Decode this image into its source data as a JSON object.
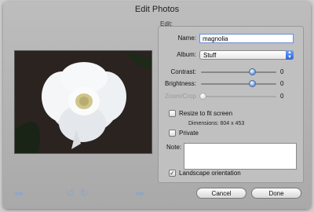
{
  "window": {
    "title": "Edit Photos"
  },
  "edit_group": {
    "label": "Edit:"
  },
  "name": {
    "label": "Name:",
    "value": "magnolia"
  },
  "album": {
    "label": "Album:",
    "value": "Stuff"
  },
  "contrast": {
    "label": "Contrast:",
    "value": "0",
    "level": 0.72
  },
  "brightness": {
    "label": "Brightness:",
    "value": "0",
    "level": 0.72
  },
  "zoom_crop": {
    "label": "Zoom/Crop",
    "value": "0",
    "level": 0.0
  },
  "resize": {
    "label": "Resize to fit screen",
    "checked": false
  },
  "dimensions": {
    "text": "Dimensions:  604 x 453"
  },
  "private": {
    "label": "Private",
    "checked": false
  },
  "note": {
    "label": "Note:",
    "value": ""
  },
  "landscape": {
    "label": "Landscape orientation",
    "checked": true
  },
  "buttons": {
    "cancel": "Cancel",
    "done": "Done"
  },
  "icons": {
    "prev": "left-arrow-icon",
    "rotate_left": "rotate-left-icon",
    "rotate_right": "rotate-right-icon",
    "next": "right-arrow-icon"
  }
}
